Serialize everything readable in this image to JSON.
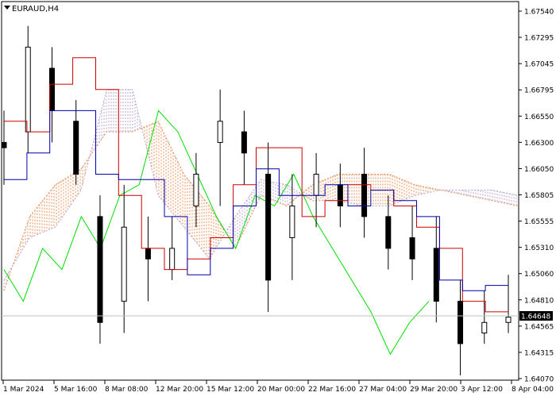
{
  "header": {
    "symbol_label": "EURAUD,H4",
    "dropdown_icon": "triangle-down-icon"
  },
  "colors": {
    "candle": "#000000",
    "tenkan": "#cc0000",
    "kijun": "#0000aa",
    "chikou": "#00dd00",
    "kumo_a": "#e8905a",
    "kumo_b": "#b8a3cc",
    "grid_line": "#c0c0c0",
    "price_badge_bg": "#000000",
    "price_badge_text": "#ffffff"
  },
  "chart_data": {
    "type": "candlestick",
    "title": "EURAUD,H4",
    "indicator": "Ichimoku Kinko Hyo",
    "ylim": [
      1.6407,
      1.6764
    ],
    "y_ticks": [
      "1.67540",
      "1.67295",
      "1.67045",
      "1.66795",
      "1.66550",
      "1.66300",
      "1.66050",
      "1.65805",
      "1.65555",
      "1.65310",
      "1.65060",
      "1.64810",
      "1.64565",
      "1.64315",
      "1.64070"
    ],
    "x_ticks": [
      "1 Mar 2024",
      "5 Mar 16:00",
      "8 Mar 08:00",
      "12 Mar 20:00",
      "15 Mar 12:00",
      "20 Mar 00:00",
      "22 Mar 16:00",
      "27 Mar 04:00",
      "29 Mar 20:00",
      "3 Apr 12:00",
      "8 Apr 04:00"
    ],
    "current_price": "1.64648",
    "candles_sampled": [
      {
        "t": "1 Mar 2024",
        "o": 1.663,
        "h": 1.666,
        "l": 1.659,
        "c": 1.6625
      },
      {
        "t": "4 Mar",
        "o": 1.664,
        "h": 1.674,
        "l": 1.662,
        "c": 1.672
      },
      {
        "t": "5 Mar 16:00",
        "o": 1.67,
        "h": 1.672,
        "l": 1.663,
        "c": 1.666
      },
      {
        "t": "6 Mar",
        "o": 1.665,
        "h": 1.667,
        "l": 1.659,
        "c": 1.66
      },
      {
        "t": "7 Mar",
        "o": 1.656,
        "h": 1.658,
        "l": 1.644,
        "c": 1.646
      },
      {
        "t": "8 Mar 08:00",
        "o": 1.648,
        "h": 1.659,
        "l": 1.645,
        "c": 1.655
      },
      {
        "t": "11 Mar",
        "o": 1.653,
        "h": 1.656,
        "l": 1.648,
        "c": 1.652
      },
      {
        "t": "12 Mar 20:00",
        "o": 1.651,
        "h": 1.656,
        "l": 1.65,
        "c": 1.653
      },
      {
        "t": "14 Mar",
        "o": 1.657,
        "h": 1.662,
        "l": 1.655,
        "c": 1.66
      },
      {
        "t": "15 Mar 12:00",
        "o": 1.663,
        "h": 1.668,
        "l": 1.657,
        "c": 1.665
      },
      {
        "t": "18 Mar",
        "o": 1.664,
        "h": 1.666,
        "l": 1.659,
        "c": 1.662
      },
      {
        "t": "20 Mar 00:00",
        "o": 1.66,
        "h": 1.663,
        "l": 1.647,
        "c": 1.65
      },
      {
        "t": "21 Mar",
        "o": 1.654,
        "h": 1.66,
        "l": 1.65,
        "c": 1.657
      },
      {
        "t": "22 Mar 16:00",
        "o": 1.658,
        "h": 1.662,
        "l": 1.655,
        "c": 1.66
      },
      {
        "t": "26 Mar",
        "o": 1.659,
        "h": 1.661,
        "l": 1.655,
        "c": 1.657
      },
      {
        "t": "27 Mar 04:00",
        "o": 1.66,
        "h": 1.6625,
        "l": 1.654,
        "c": 1.656
      },
      {
        "t": "28 Mar",
        "o": 1.656,
        "h": 1.658,
        "l": 1.651,
        "c": 1.653
      },
      {
        "t": "29 Mar 20:00",
        "o": 1.654,
        "h": 1.657,
        "l": 1.65,
        "c": 1.652
      },
      {
        "t": "2 Apr",
        "o": 1.653,
        "h": 1.656,
        "l": 1.646,
        "c": 1.648
      },
      {
        "t": "3 Apr 12:00",
        "o": 1.648,
        "h": 1.65,
        "l": 1.641,
        "c": 1.644
      },
      {
        "t": "5 Apr",
        "o": 1.645,
        "h": 1.649,
        "l": 1.644,
        "c": 1.646
      },
      {
        "t": "8 Apr 04:00",
        "o": 1.646,
        "h": 1.6505,
        "l": 1.645,
        "c": 1.6465
      }
    ],
    "tenkan_sen": [
      1.665,
      1.664,
      1.6685,
      1.671,
      1.668,
      1.658,
      1.653,
      1.651,
      1.652,
      1.654,
      1.659,
      1.6625,
      1.6625,
      1.656,
      1.6575,
      1.659,
      1.6585,
      1.657,
      1.655,
      1.653,
      1.648,
      1.647,
      1.647
    ],
    "kijun_sen": [
      1.6595,
      1.662,
      1.666,
      1.666,
      1.66,
      1.6595,
      1.6595,
      1.656,
      1.6505,
      1.653,
      1.657,
      1.6605,
      1.658,
      1.658,
      1.659,
      1.657,
      1.6585,
      1.6575,
      1.656,
      1.65,
      1.649,
      1.6495,
      1.6495
    ],
    "senkou_span_a": [
      1.649,
      1.656,
      1.659,
      1.6605,
      1.664,
      1.664,
      1.665,
      1.66,
      1.657,
      1.653,
      1.658,
      1.657,
      1.659,
      1.66,
      1.66,
      1.66,
      1.659,
      1.6585,
      1.658,
      1.6575,
      1.657
    ],
    "senkou_span_b": [
      1.65,
      1.654,
      1.655,
      1.6585,
      1.668,
      1.668,
      1.658,
      1.655,
      1.652,
      1.656,
      1.6595,
      1.659,
      1.6575,
      1.6575,
      1.657,
      1.657,
      1.658,
      1.6585,
      1.6585,
      1.6585,
      1.658
    ],
    "chikou_span": [
      1.651,
      1.648,
      1.653,
      1.651,
      1.656,
      1.653,
      1.658,
      1.659,
      1.666,
      1.664,
      1.66,
      1.656,
      1.653,
      1.658,
      1.657,
      1.66,
      1.656,
      1.653,
      1.65,
      1.647,
      1.643,
      1.646,
      1.648
    ]
  }
}
